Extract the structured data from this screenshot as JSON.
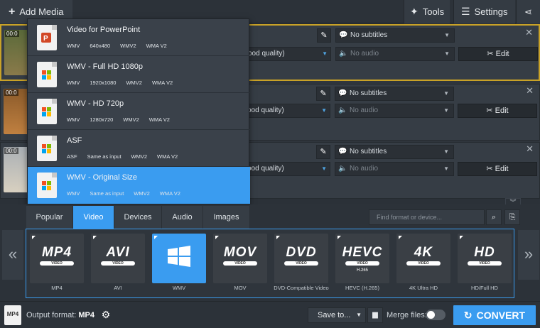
{
  "topbar": {
    "add_media": "Add Media",
    "tools": "Tools",
    "settings": "Settings"
  },
  "rows": [
    {
      "time": "00:0",
      "quality": "ood quality)",
      "subtitles": "No subtitles",
      "audio": "No audio",
      "edit": "Edit"
    },
    {
      "time": "00:0",
      "quality": "ood quality)",
      "subtitles": "No subtitles",
      "audio": "No audio",
      "edit": "Edit"
    },
    {
      "time": "00:0",
      "quality": "ood quality)",
      "subtitles": "No subtitles",
      "audio": "No audio",
      "edit": "Edit"
    }
  ],
  "presets": [
    {
      "name": "Video for PowerPoint",
      "specs": [
        "WMV",
        "640x480",
        "WMV2",
        "WMA V2"
      ]
    },
    {
      "name": "WMV - Full HD 1080p",
      "specs": [
        "WMV",
        "1920x1080",
        "WMV2",
        "WMA V2"
      ]
    },
    {
      "name": "WMV - HD 720p",
      "specs": [
        "WMV",
        "1280x720",
        "WMV2",
        "WMA V2"
      ]
    },
    {
      "name": "ASF",
      "specs": [
        "ASF",
        "Same as input",
        "WMV2",
        "WMA V2"
      ]
    },
    {
      "name": "WMV - Original Size",
      "specs": [
        "WMV",
        "Same as input",
        "WMV2",
        "WMA V2"
      ]
    }
  ],
  "tabs": [
    "Popular",
    "Video",
    "Devices",
    "Audio",
    "Images"
  ],
  "search_placeholder": "Find format or device...",
  "formats": [
    {
      "badge": "MP4",
      "pill": "VIDEO",
      "sub": "",
      "label": "MP4"
    },
    {
      "badge": "AVI",
      "pill": "VIDEO",
      "sub": "",
      "label": "AVI"
    },
    {
      "badge": "",
      "pill": "",
      "sub": "",
      "label": "WMV"
    },
    {
      "badge": "MOV",
      "pill": "VIDEO",
      "sub": "",
      "label": "MOV"
    },
    {
      "badge": "DVD",
      "pill": "VIDEO",
      "sub": "",
      "label": "DVD-Compatible Video"
    },
    {
      "badge": "HEVC",
      "pill": "VIDEO",
      "sub": "H.265",
      "label": "HEVC (H.265)"
    },
    {
      "badge": "4K",
      "pill": "VIDEO",
      "sub": "",
      "label": "4K Ultra HD"
    },
    {
      "badge": "HD",
      "pill": "VIDEO",
      "sub": "",
      "label": "HD/Full HD"
    }
  ],
  "bottom": {
    "output_label": "Output format:",
    "output_value": "MP4",
    "save_to": "Save to...",
    "merge": "Merge files:",
    "convert": "CONVERT",
    "out_icon": "MP4"
  },
  "colors": {
    "accent": "#3a9cf0",
    "selected_border": "#c9a227",
    "background": "#2b3138"
  }
}
